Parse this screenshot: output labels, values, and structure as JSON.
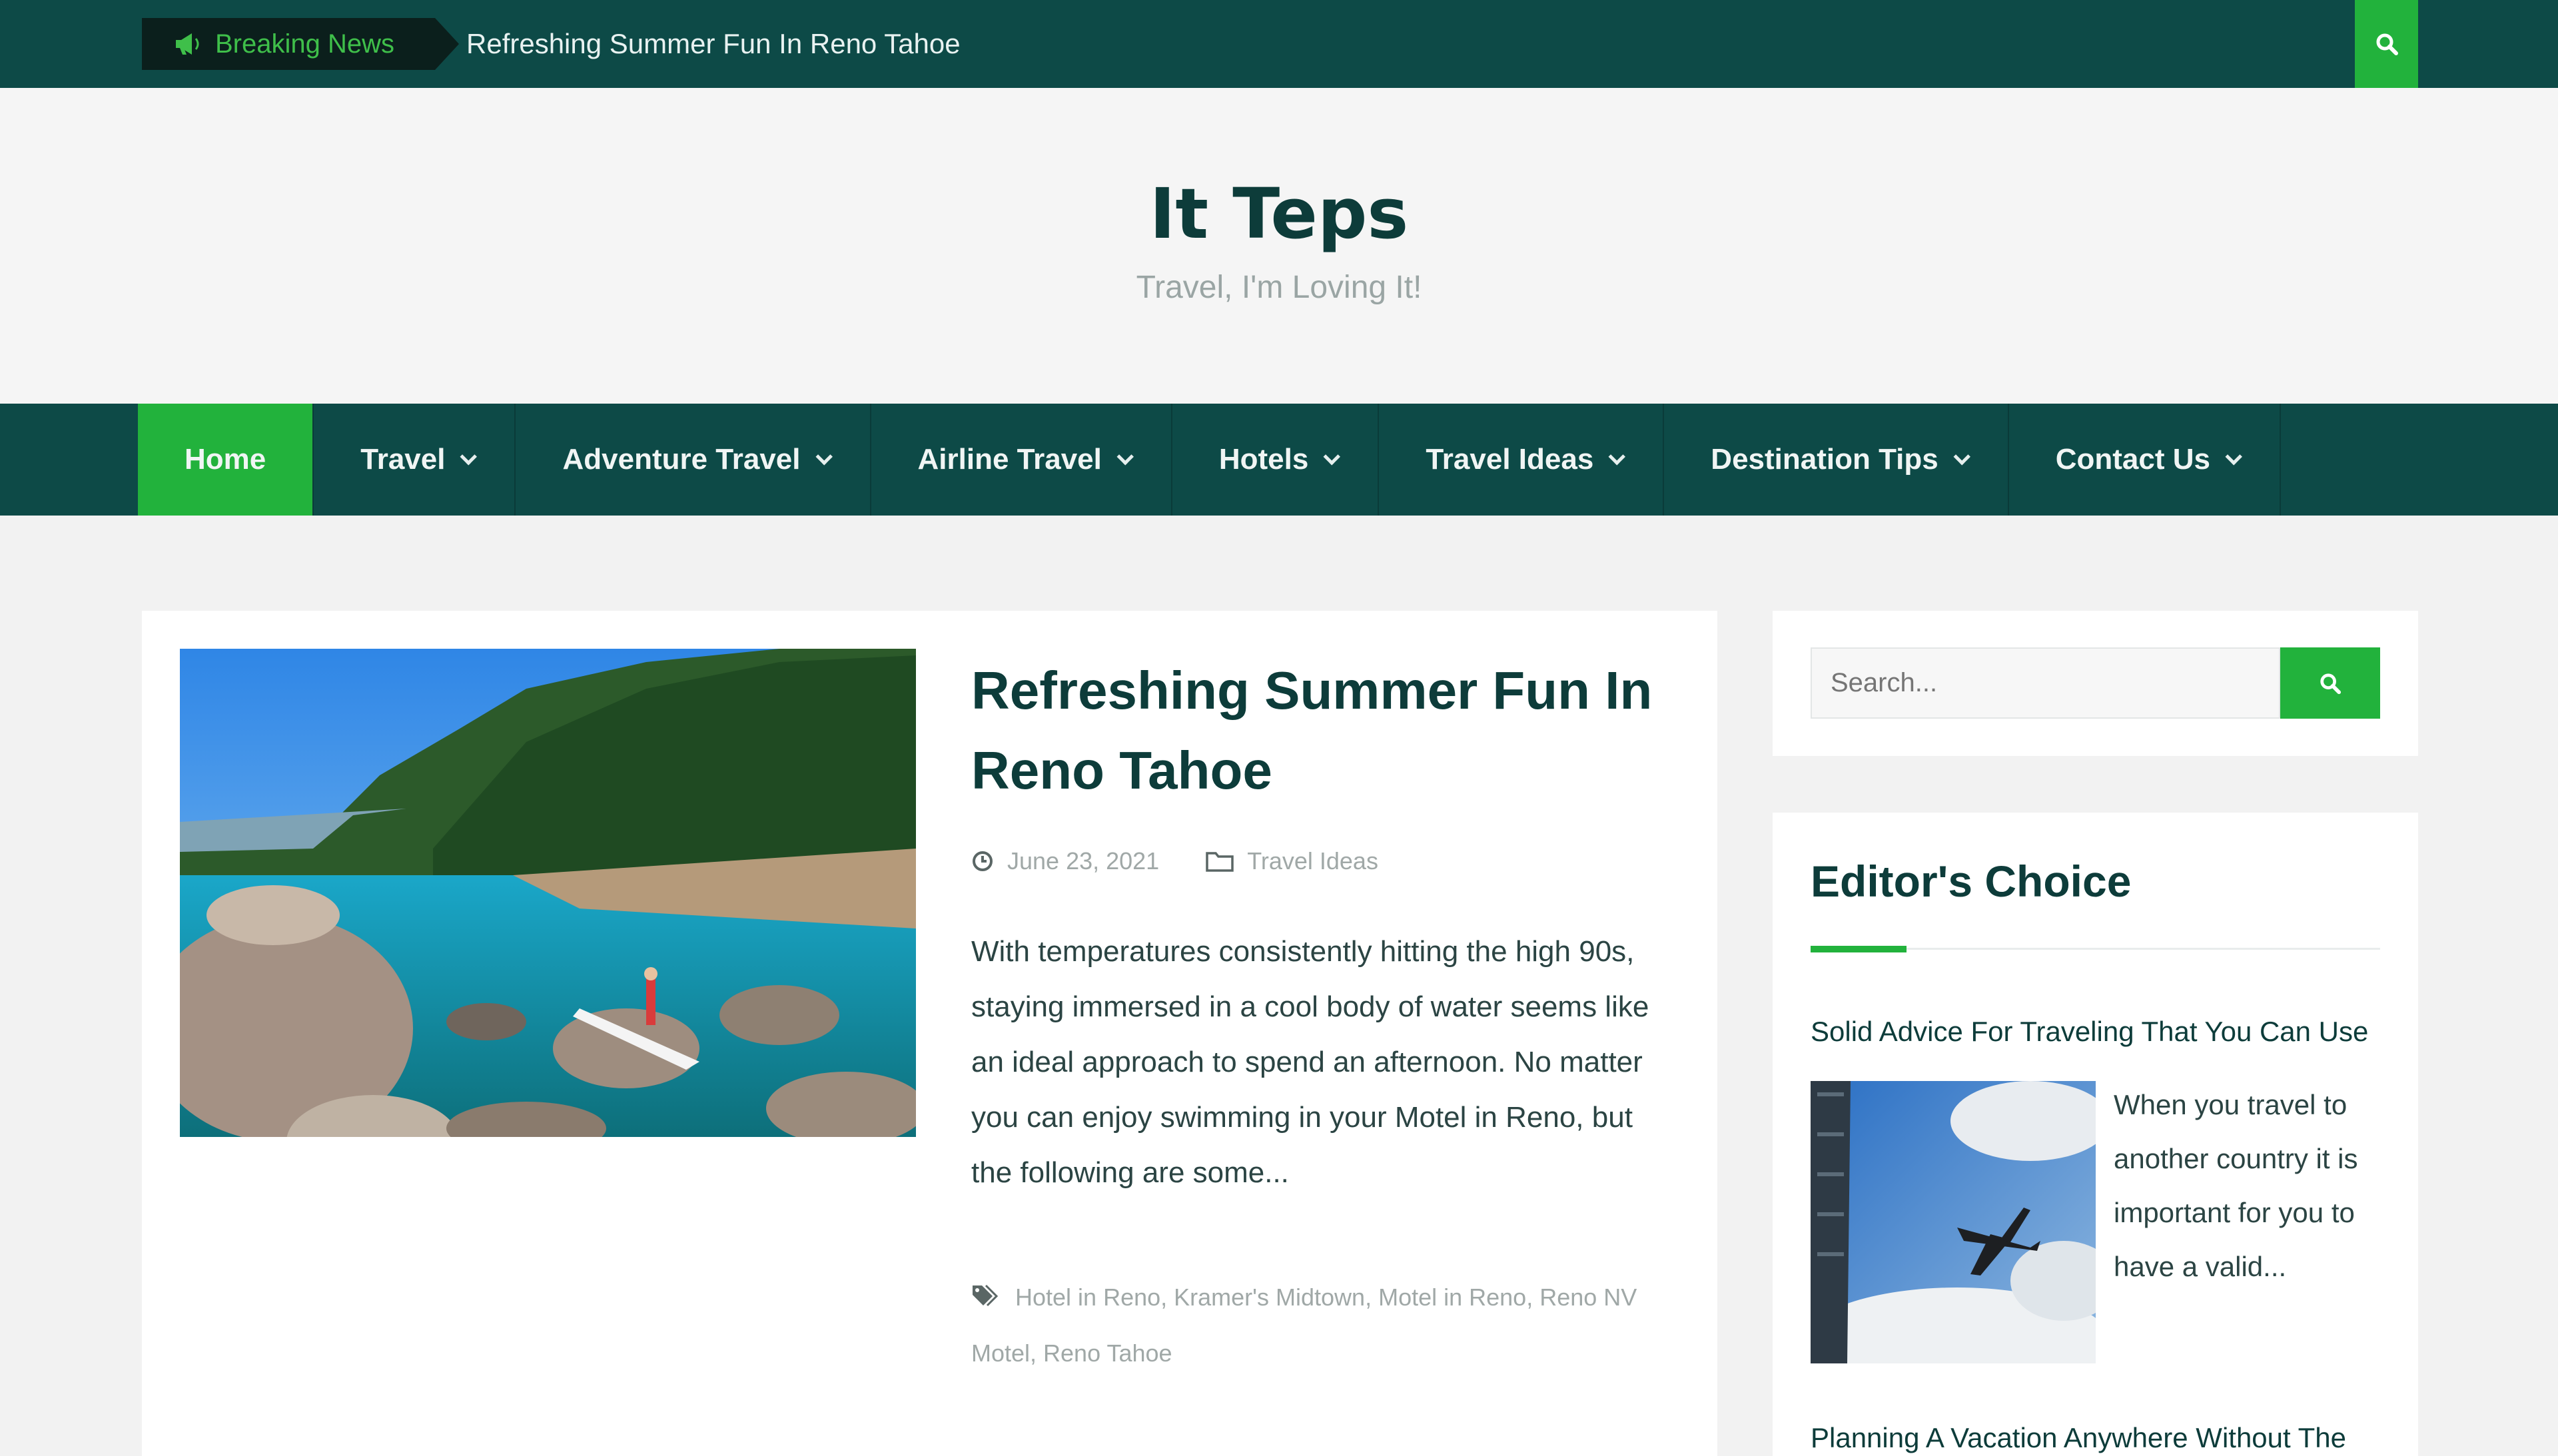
{
  "topbar": {
    "breaking_label": "Breaking News",
    "ticker_text": "Refreshing Summer Fun In Reno Tahoe",
    "icons": {
      "megaphone": "megaphone-icon",
      "search": "search-icon"
    }
  },
  "header": {
    "title": "It Teps",
    "tagline": "Travel, I'm Loving It!"
  },
  "nav": {
    "items": [
      {
        "label": "Home",
        "active": true,
        "dropdown": false
      },
      {
        "label": "Travel",
        "active": false,
        "dropdown": true
      },
      {
        "label": "Adventure Travel",
        "active": false,
        "dropdown": true
      },
      {
        "label": "Airline Travel",
        "active": false,
        "dropdown": true
      },
      {
        "label": "Hotels",
        "active": false,
        "dropdown": true
      },
      {
        "label": "Travel Ideas",
        "active": false,
        "dropdown": true
      },
      {
        "label": "Destination Tips",
        "active": false,
        "dropdown": true
      },
      {
        "label": "Contact Us",
        "active": false,
        "dropdown": true
      }
    ]
  },
  "post": {
    "title": "Refreshing Summer Fun In Reno Tahoe",
    "date": "June 23, 2021",
    "category": "Travel Ideas",
    "excerpt": "With temperatures consistently hitting the high 90s, staying immersed in a cool body of water seems like an ideal approach to spend an afternoon. No matter you can enjoy swimming in your Motel in Reno, but the following are some...",
    "tags": "Hotel in Reno, Kramer's Midtown, Motel in Reno, Reno NV Motel, Reno Tahoe",
    "image_alt": "lake-tahoe-paddleboard-image"
  },
  "sidebar": {
    "search_placeholder": "Search...",
    "editors_choice": {
      "heading": "Editor's Choice",
      "item1_title": "Solid Advice For Traveling That You Can Use",
      "item1_excerpt": "When you travel to another country it is important for you to have a valid...",
      "item2_title": "Planning A Vacation Anywhere Without The"
    }
  },
  "colors": {
    "dark_teal": "#0d4a47",
    "accent_green": "#22b23c",
    "title_text": "#0d3c3a",
    "muted_text": "#a0a8a7"
  }
}
